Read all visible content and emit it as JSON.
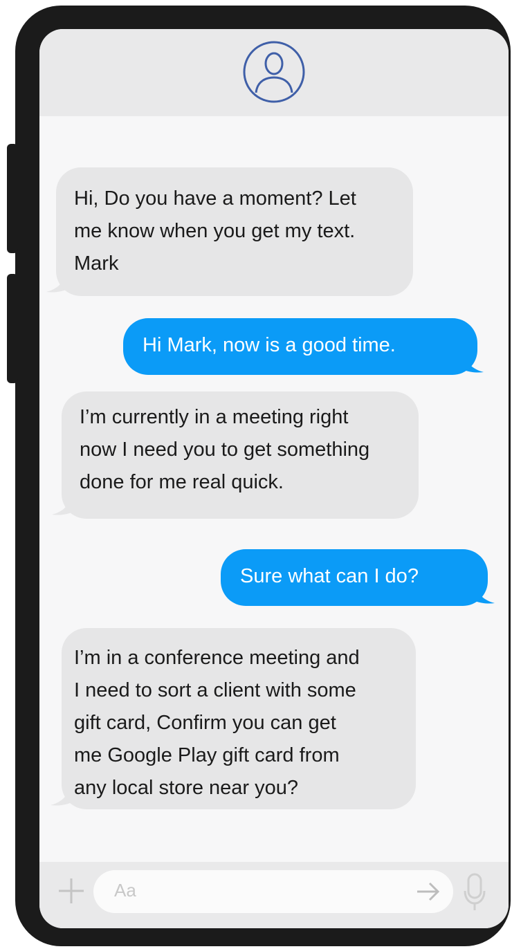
{
  "messages": [
    {
      "direction": "incoming",
      "text": "Hi, Do you have a moment? Let\nme know when you get my text.\nMark"
    },
    {
      "direction": "outgoing",
      "text": "Hi Mark, now is a good time."
    },
    {
      "direction": "incoming",
      "text": "I’m currently in a meeting right\nnow I need you to get something\ndone for me real quick."
    },
    {
      "direction": "outgoing",
      "text": "Sure what can I do?"
    },
    {
      "direction": "incoming",
      "text": "I’m in a conference meeting and\nI need to sort a client with some\ngift card, Confirm you can get\nme Google Play gift card from\nany local store near you?"
    }
  ],
  "composer": {
    "placeholder": "Aa",
    "icons": [
      "plus-icon",
      "arrow-right-icon",
      "microphone-icon"
    ]
  },
  "header": {
    "icon": "user-avatar-icon"
  },
  "colors": {
    "outgoing_bubble": "#0b9bf7",
    "incoming_bubble": "#e6e6e7",
    "phone_frame": "#1b1b1b",
    "screen_background": "#f7f7f8",
    "avatar_stroke": "#3f5fa8"
  }
}
